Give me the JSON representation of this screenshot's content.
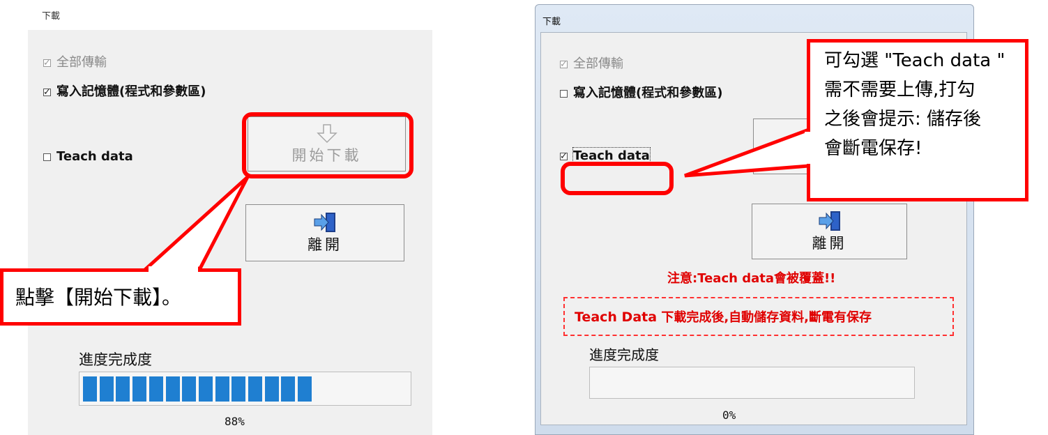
{
  "left": {
    "title": "下載",
    "options": {
      "transfer_all": "全部傳輸",
      "write_memory": "寫入記憶體(程式和參數區)",
      "teach_data": "Teach data"
    },
    "start_download_label": "開始下載",
    "exit_label": "離開",
    "callout_text": "點擊【開始下載】。",
    "progress_label": "進度完成度",
    "progress_value": 0.88,
    "progress_text": "88%"
  },
  "right": {
    "title": "下載",
    "options": {
      "transfer_all": "全部傳輸",
      "write_memory": "寫入記憶體(程式和參數區)",
      "teach_data": "Teach data"
    },
    "callout_lines": [
      "可勾選 \"Teach data \"",
      "需不需要上傳,打勾",
      "之後會提示: 儲存後",
      "會斷電保存!"
    ],
    "exit_label": "離開",
    "warning_text": "注意:Teach data會被覆蓋!!",
    "info_text_bold": "Teach Data",
    "info_text_rest": " 下載完成後,自動儲存資料,斷電有保存",
    "progress_label": "進度完成度",
    "progress_value": 0,
    "progress_text": "0%"
  },
  "colors": {
    "annotation_red": "#ff0000",
    "progress_blue": "#1f7fd1",
    "warning_red": "#e00000"
  }
}
